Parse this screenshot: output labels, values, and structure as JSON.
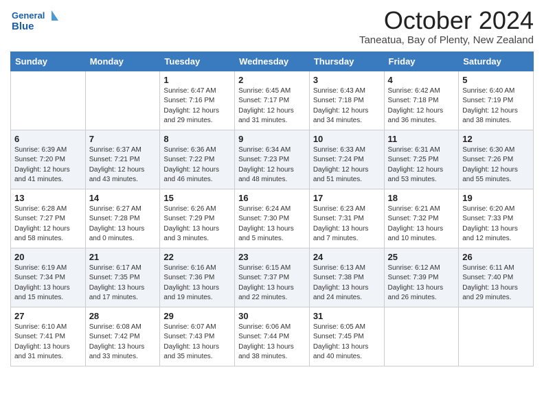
{
  "header": {
    "logo_text_general": "General",
    "logo_text_blue": "Blue",
    "month_title": "October 2024",
    "subtitle": "Taneatua, Bay of Plenty, New Zealand"
  },
  "days_of_week": [
    "Sunday",
    "Monday",
    "Tuesday",
    "Wednesday",
    "Thursday",
    "Friday",
    "Saturday"
  ],
  "weeks": [
    [
      {
        "day": "",
        "content": ""
      },
      {
        "day": "",
        "content": ""
      },
      {
        "day": "1",
        "content": "Sunrise: 6:47 AM\nSunset: 7:16 PM\nDaylight: 12 hours and 29 minutes."
      },
      {
        "day": "2",
        "content": "Sunrise: 6:45 AM\nSunset: 7:17 PM\nDaylight: 12 hours and 31 minutes."
      },
      {
        "day": "3",
        "content": "Sunrise: 6:43 AM\nSunset: 7:18 PM\nDaylight: 12 hours and 34 minutes."
      },
      {
        "day": "4",
        "content": "Sunrise: 6:42 AM\nSunset: 7:18 PM\nDaylight: 12 hours and 36 minutes."
      },
      {
        "day": "5",
        "content": "Sunrise: 6:40 AM\nSunset: 7:19 PM\nDaylight: 12 hours and 38 minutes."
      }
    ],
    [
      {
        "day": "6",
        "content": "Sunrise: 6:39 AM\nSunset: 7:20 PM\nDaylight: 12 hours and 41 minutes."
      },
      {
        "day": "7",
        "content": "Sunrise: 6:37 AM\nSunset: 7:21 PM\nDaylight: 12 hours and 43 minutes."
      },
      {
        "day": "8",
        "content": "Sunrise: 6:36 AM\nSunset: 7:22 PM\nDaylight: 12 hours and 46 minutes."
      },
      {
        "day": "9",
        "content": "Sunrise: 6:34 AM\nSunset: 7:23 PM\nDaylight: 12 hours and 48 minutes."
      },
      {
        "day": "10",
        "content": "Sunrise: 6:33 AM\nSunset: 7:24 PM\nDaylight: 12 hours and 51 minutes."
      },
      {
        "day": "11",
        "content": "Sunrise: 6:31 AM\nSunset: 7:25 PM\nDaylight: 12 hours and 53 minutes."
      },
      {
        "day": "12",
        "content": "Sunrise: 6:30 AM\nSunset: 7:26 PM\nDaylight: 12 hours and 55 minutes."
      }
    ],
    [
      {
        "day": "13",
        "content": "Sunrise: 6:28 AM\nSunset: 7:27 PM\nDaylight: 12 hours and 58 minutes."
      },
      {
        "day": "14",
        "content": "Sunrise: 6:27 AM\nSunset: 7:28 PM\nDaylight: 13 hours and 0 minutes."
      },
      {
        "day": "15",
        "content": "Sunrise: 6:26 AM\nSunset: 7:29 PM\nDaylight: 13 hours and 3 minutes."
      },
      {
        "day": "16",
        "content": "Sunrise: 6:24 AM\nSunset: 7:30 PM\nDaylight: 13 hours and 5 minutes."
      },
      {
        "day": "17",
        "content": "Sunrise: 6:23 AM\nSunset: 7:31 PM\nDaylight: 13 hours and 7 minutes."
      },
      {
        "day": "18",
        "content": "Sunrise: 6:21 AM\nSunset: 7:32 PM\nDaylight: 13 hours and 10 minutes."
      },
      {
        "day": "19",
        "content": "Sunrise: 6:20 AM\nSunset: 7:33 PM\nDaylight: 13 hours and 12 minutes."
      }
    ],
    [
      {
        "day": "20",
        "content": "Sunrise: 6:19 AM\nSunset: 7:34 PM\nDaylight: 13 hours and 15 minutes."
      },
      {
        "day": "21",
        "content": "Sunrise: 6:17 AM\nSunset: 7:35 PM\nDaylight: 13 hours and 17 minutes."
      },
      {
        "day": "22",
        "content": "Sunrise: 6:16 AM\nSunset: 7:36 PM\nDaylight: 13 hours and 19 minutes."
      },
      {
        "day": "23",
        "content": "Sunrise: 6:15 AM\nSunset: 7:37 PM\nDaylight: 13 hours and 22 minutes."
      },
      {
        "day": "24",
        "content": "Sunrise: 6:13 AM\nSunset: 7:38 PM\nDaylight: 13 hours and 24 minutes."
      },
      {
        "day": "25",
        "content": "Sunrise: 6:12 AM\nSunset: 7:39 PM\nDaylight: 13 hours and 26 minutes."
      },
      {
        "day": "26",
        "content": "Sunrise: 6:11 AM\nSunset: 7:40 PM\nDaylight: 13 hours and 29 minutes."
      }
    ],
    [
      {
        "day": "27",
        "content": "Sunrise: 6:10 AM\nSunset: 7:41 PM\nDaylight: 13 hours and 31 minutes."
      },
      {
        "day": "28",
        "content": "Sunrise: 6:08 AM\nSunset: 7:42 PM\nDaylight: 13 hours and 33 minutes."
      },
      {
        "day": "29",
        "content": "Sunrise: 6:07 AM\nSunset: 7:43 PM\nDaylight: 13 hours and 35 minutes."
      },
      {
        "day": "30",
        "content": "Sunrise: 6:06 AM\nSunset: 7:44 PM\nDaylight: 13 hours and 38 minutes."
      },
      {
        "day": "31",
        "content": "Sunrise: 6:05 AM\nSunset: 7:45 PM\nDaylight: 13 hours and 40 minutes."
      },
      {
        "day": "",
        "content": ""
      },
      {
        "day": "",
        "content": ""
      }
    ]
  ]
}
